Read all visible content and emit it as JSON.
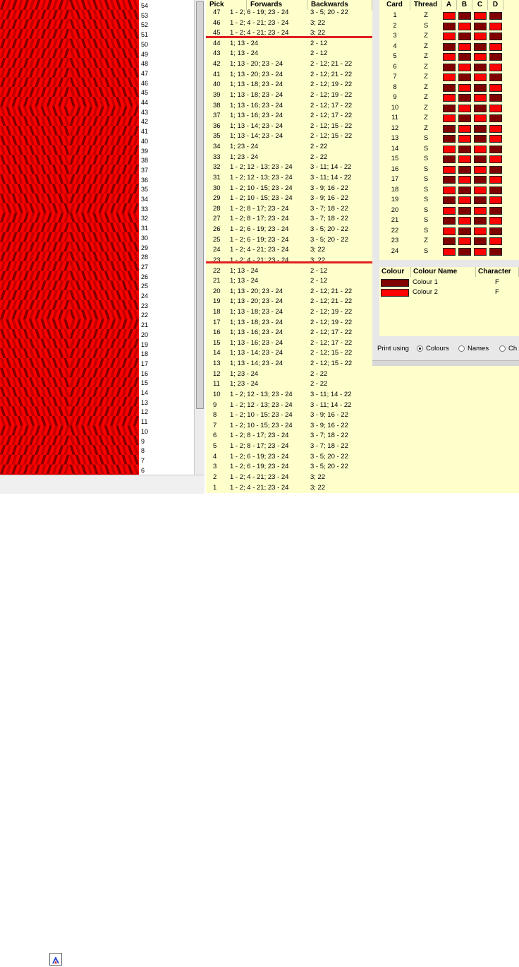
{
  "row_numbers": [
    "54",
    "53",
    "52",
    "51",
    "50",
    "49",
    "48",
    "47",
    "46",
    "45",
    "44",
    "43",
    "42",
    "41",
    "40",
    "39",
    "38",
    "37",
    "36",
    "35",
    "34",
    "33",
    "32",
    "31",
    "30",
    "29",
    "28",
    "27",
    "26",
    "25",
    "24",
    "23",
    "22",
    "21",
    "20",
    "19",
    "18",
    "17",
    "16",
    "15",
    "14",
    "13",
    "12",
    "11",
    "10",
    "9",
    "8",
    "7",
    "6"
  ],
  "picks": {
    "headers": {
      "pick": "Pick",
      "forwards": "Forwards",
      "backwards": "Backwards"
    },
    "rows": [
      [
        "47",
        "1 - 2; 6 - 19; 23 - 24",
        "3 - 5; 20 - 22"
      ],
      [
        "46",
        "1 - 2; 4 - 21; 23 - 24",
        "3; 22"
      ],
      [
        "45",
        "1 - 2; 4 - 21; 23 - 24",
        "3; 22"
      ],
      [
        "44",
        "1; 13 - 24",
        "2 - 12"
      ],
      [
        "43",
        "1; 13 - 24",
        "2 - 12"
      ],
      [
        "42",
        "1; 13 - 20; 23 - 24",
        "2 - 12; 21 - 22"
      ],
      [
        "41",
        "1; 13 - 20; 23 - 24",
        "2 - 12; 21 - 22"
      ],
      [
        "40",
        "1; 13 - 18; 23 - 24",
        "2 - 12; 19 - 22"
      ],
      [
        "39",
        "1; 13 - 18; 23 - 24",
        "2 - 12; 19 - 22"
      ],
      [
        "38",
        "1; 13 - 16; 23 - 24",
        "2 - 12; 17 - 22"
      ],
      [
        "37",
        "1; 13 - 16; 23 - 24",
        "2 - 12; 17 - 22"
      ],
      [
        "36",
        "1; 13 - 14; 23 - 24",
        "2 - 12; 15 - 22"
      ],
      [
        "35",
        "1; 13 - 14; 23 - 24",
        "2 - 12; 15 - 22"
      ],
      [
        "34",
        "1; 23 - 24",
        "2 - 22"
      ],
      [
        "33",
        "1; 23 - 24",
        "2 - 22"
      ],
      [
        "32",
        "1 - 2; 12 - 13; 23 - 24",
        "3 - 11; 14 - 22"
      ],
      [
        "31",
        "1 - 2; 12 - 13; 23 - 24",
        "3 - 11; 14 - 22"
      ],
      [
        "30",
        "1 - 2; 10 - 15; 23 - 24",
        "3 - 9; 16 - 22"
      ],
      [
        "29",
        "1 - 2; 10 - 15; 23 - 24",
        "3 - 9; 16 - 22"
      ],
      [
        "28",
        "1 - 2; 8 - 17; 23 - 24",
        "3 - 7; 18 - 22"
      ],
      [
        "27",
        "1 - 2; 8 - 17; 23 - 24",
        "3 - 7; 18 - 22"
      ],
      [
        "26",
        "1 - 2; 6 - 19; 23 - 24",
        "3 - 5; 20 - 22"
      ],
      [
        "25",
        "1 - 2; 6 - 19; 23 - 24",
        "3 - 5; 20 - 22"
      ],
      [
        "24",
        "1 - 2; 4 - 21; 23 - 24",
        "3; 22"
      ],
      [
        "23",
        "1 - 2; 4 - 21; 23 - 24",
        "3; 22"
      ],
      [
        "22",
        "1; 13 - 24",
        "2 - 12"
      ],
      [
        "21",
        "1; 13 - 24",
        "2 - 12"
      ],
      [
        "20",
        "1; 13 - 20; 23 - 24",
        "2 - 12; 21 - 22"
      ],
      [
        "19",
        "1; 13 - 20; 23 - 24",
        "2 - 12; 21 - 22"
      ],
      [
        "18",
        "1; 13 - 18; 23 - 24",
        "2 - 12; 19 - 22"
      ],
      [
        "17",
        "1; 13 - 18; 23 - 24",
        "2 - 12; 19 - 22"
      ],
      [
        "16",
        "1; 13 - 16; 23 - 24",
        "2 - 12; 17 - 22"
      ],
      [
        "15",
        "1; 13 - 16; 23 - 24",
        "2 - 12; 17 - 22"
      ],
      [
        "14",
        "1; 13 - 14; 23 - 24",
        "2 - 12; 15 - 22"
      ],
      [
        "13",
        "1; 13 - 14; 23 - 24",
        "2 - 12; 15 - 22"
      ],
      [
        "12",
        "1; 23 - 24",
        "2 - 22"
      ],
      [
        "11",
        "1; 23 - 24",
        "2 - 22"
      ],
      [
        "10",
        "1 - 2; 12 - 13; 23 - 24",
        "3 - 11; 14 - 22"
      ],
      [
        "9",
        "1 - 2; 12 - 13; 23 - 24",
        "3 - 11; 14 - 22"
      ],
      [
        "8",
        "1 - 2; 10 - 15; 23 - 24",
        "3 - 9; 16 - 22"
      ],
      [
        "7",
        "1 - 2; 10 - 15; 23 - 24",
        "3 - 9; 16 - 22"
      ],
      [
        "6",
        "1 - 2; 8 - 17; 23 - 24",
        "3 - 7; 18 - 22"
      ],
      [
        "5",
        "1 - 2; 8 - 17; 23 - 24",
        "3 - 7; 18 - 22"
      ],
      [
        "4",
        "1 - 2; 6 - 19; 23 - 24",
        "3 - 5; 20 - 22"
      ],
      [
        "3",
        "1 - 2; 6 - 19; 23 - 24",
        "3 - 5; 20 - 22"
      ],
      [
        "2",
        "1 - 2; 4 - 21; 23 - 24",
        "3; 22"
      ],
      [
        "1",
        "1 - 2; 4 - 21; 23 - 24",
        "3; 22"
      ]
    ]
  },
  "cards": {
    "headers": {
      "card": "Card",
      "thread": "Thread",
      "a": "A",
      "b": "B",
      "c": "C",
      "d": "D"
    },
    "rows": [
      [
        "1",
        "Z"
      ],
      [
        "2",
        "S"
      ],
      [
        "3",
        "Z"
      ],
      [
        "4",
        "Z"
      ],
      [
        "5",
        "Z"
      ],
      [
        "6",
        "Z"
      ],
      [
        "7",
        "Z"
      ],
      [
        "8",
        "Z"
      ],
      [
        "9",
        "Z"
      ],
      [
        "10",
        "Z"
      ],
      [
        "11",
        "Z"
      ],
      [
        "12",
        "Z"
      ],
      [
        "13",
        "S"
      ],
      [
        "14",
        "S"
      ],
      [
        "15",
        "S"
      ],
      [
        "16",
        "S"
      ],
      [
        "17",
        "S"
      ],
      [
        "18",
        "S"
      ],
      [
        "19",
        "S"
      ],
      [
        "20",
        "S"
      ],
      [
        "21",
        "S"
      ],
      [
        "22",
        "S"
      ],
      [
        "23",
        "Z"
      ],
      [
        "24",
        "S"
      ]
    ],
    "threading_colors": [
      [
        2,
        1,
        2,
        1
      ],
      [
        1,
        2,
        1,
        2
      ],
      [
        2,
        1,
        2,
        1
      ],
      [
        1,
        2,
        1,
        2
      ],
      [
        2,
        1,
        2,
        1
      ],
      [
        1,
        2,
        1,
        2
      ],
      [
        2,
        1,
        2,
        1
      ],
      [
        1,
        2,
        1,
        2
      ],
      [
        2,
        1,
        2,
        1
      ],
      [
        1,
        2,
        1,
        2
      ],
      [
        2,
        1,
        2,
        1
      ],
      [
        1,
        2,
        1,
        2
      ],
      [
        1,
        2,
        1,
        2
      ],
      [
        2,
        1,
        2,
        1
      ],
      [
        1,
        2,
        1,
        2
      ],
      [
        2,
        1,
        2,
        1
      ],
      [
        1,
        2,
        1,
        2
      ],
      [
        2,
        1,
        2,
        1
      ],
      [
        1,
        2,
        1,
        2
      ],
      [
        2,
        1,
        2,
        1
      ],
      [
        1,
        2,
        1,
        2
      ],
      [
        2,
        1,
        2,
        1
      ],
      [
        1,
        2,
        1,
        2
      ],
      [
        2,
        1,
        2,
        1
      ]
    ]
  },
  "colours": {
    "headers": {
      "colour": "Colour",
      "name": "Colour Name",
      "character": "Character"
    },
    "rows": [
      {
        "name": "Colour 1",
        "character": "F",
        "hex": "#800000"
      },
      {
        "name": "Colour 2",
        "character": "F",
        "hex": "#ff0000"
      }
    ]
  },
  "print_options": {
    "label": "Print using",
    "options": [
      "Colours",
      "Names",
      "Ch"
    ],
    "selected": "Colours"
  },
  "palette": {
    "colour1": "#800000",
    "colour2": "#ff0000",
    "panel_bg": "#ffffcc",
    "divider_line": "#e02020"
  }
}
